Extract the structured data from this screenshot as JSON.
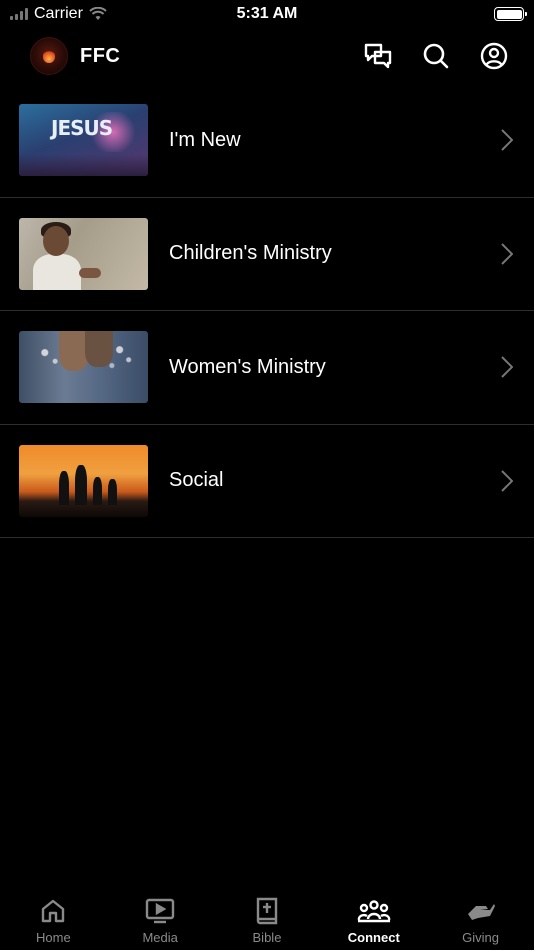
{
  "status_bar": {
    "carrier": "Carrier",
    "time": "5:31 AM",
    "battery_level": 1.0
  },
  "header": {
    "title": "FFC",
    "logo_icon": "church-logo",
    "actions": [
      {
        "icon": "chat-bubbles-icon"
      },
      {
        "icon": "search-icon"
      },
      {
        "icon": "profile-icon"
      }
    ]
  },
  "list": {
    "items": [
      {
        "label": "I'm New",
        "thumb_text": "JESUS"
      },
      {
        "label": "Children's Ministry"
      },
      {
        "label": "Women's Ministry"
      },
      {
        "label": "Social"
      }
    ]
  },
  "tabbar": {
    "tabs": [
      {
        "label": "Home",
        "icon": "home-icon",
        "active": false
      },
      {
        "label": "Media",
        "icon": "play-icon",
        "active": false
      },
      {
        "label": "Bible",
        "icon": "bible-icon",
        "active": false
      },
      {
        "label": "Connect",
        "icon": "people-icon",
        "active": true
      },
      {
        "label": "Giving",
        "icon": "giving-hand-icon",
        "active": false
      }
    ]
  },
  "colors": {
    "background": "#000000",
    "text": "#ffffff",
    "inactive_tab": "#8a8a8a",
    "divider": "#2e2e2e"
  }
}
